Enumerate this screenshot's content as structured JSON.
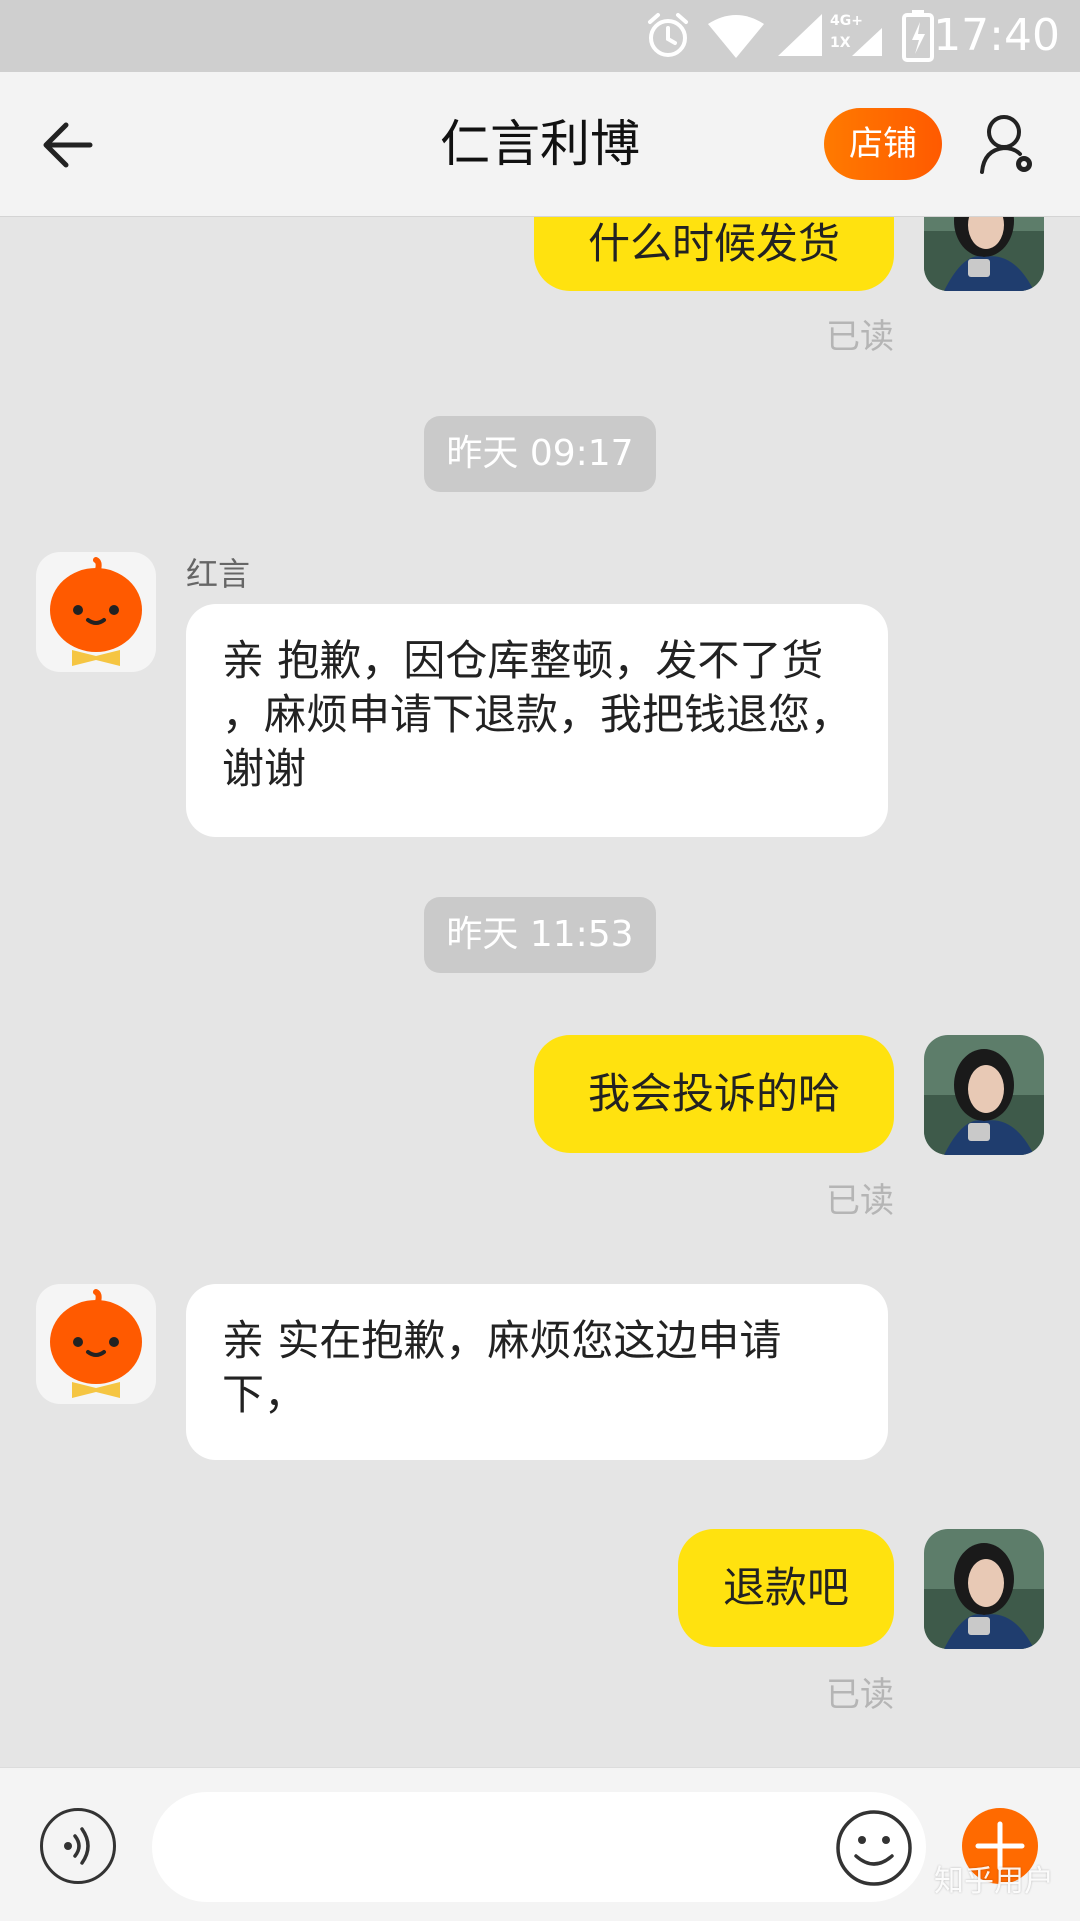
{
  "status_bar": {
    "time": "17:40",
    "network_label_top": "4G+",
    "network_label_bottom": "1X",
    "icons": [
      "alarm-icon",
      "wifi-icon",
      "signal-icon",
      "signal-icon-2",
      "battery-icon"
    ]
  },
  "header": {
    "title": "仁言利博",
    "store_label": "店铺",
    "back_icon": "back-arrow-icon",
    "profile_icon": "user-settings-icon"
  },
  "colors": {
    "my_bubble": "#ffe20f",
    "store_button": "#ff6a00",
    "background": "#e5e5e5"
  },
  "messages": [
    {
      "side": "me",
      "text": "什么时候发货",
      "status": "已读"
    },
    {
      "timestamp": "昨天  09:17"
    },
    {
      "side": "other",
      "sender": "红言",
      "text": "亲 抱歉，因仓库整顿，发不了货 ，麻烦申请下退款，我把钱退您，谢谢"
    },
    {
      "timestamp": "昨天  11:53"
    },
    {
      "side": "me",
      "text": "我会投诉的哈",
      "status": "已读"
    },
    {
      "side": "other",
      "text": "亲 实在抱歉，麻烦您这边申请下，"
    },
    {
      "side": "me",
      "text": "退款吧",
      "status": "已读"
    }
  ],
  "input_bar": {
    "placeholder": "",
    "voice_icon": "voice-icon",
    "emoji_icon": "emoji-icon",
    "plus_icon": "plus-icon"
  },
  "watermark": "知乎用户"
}
